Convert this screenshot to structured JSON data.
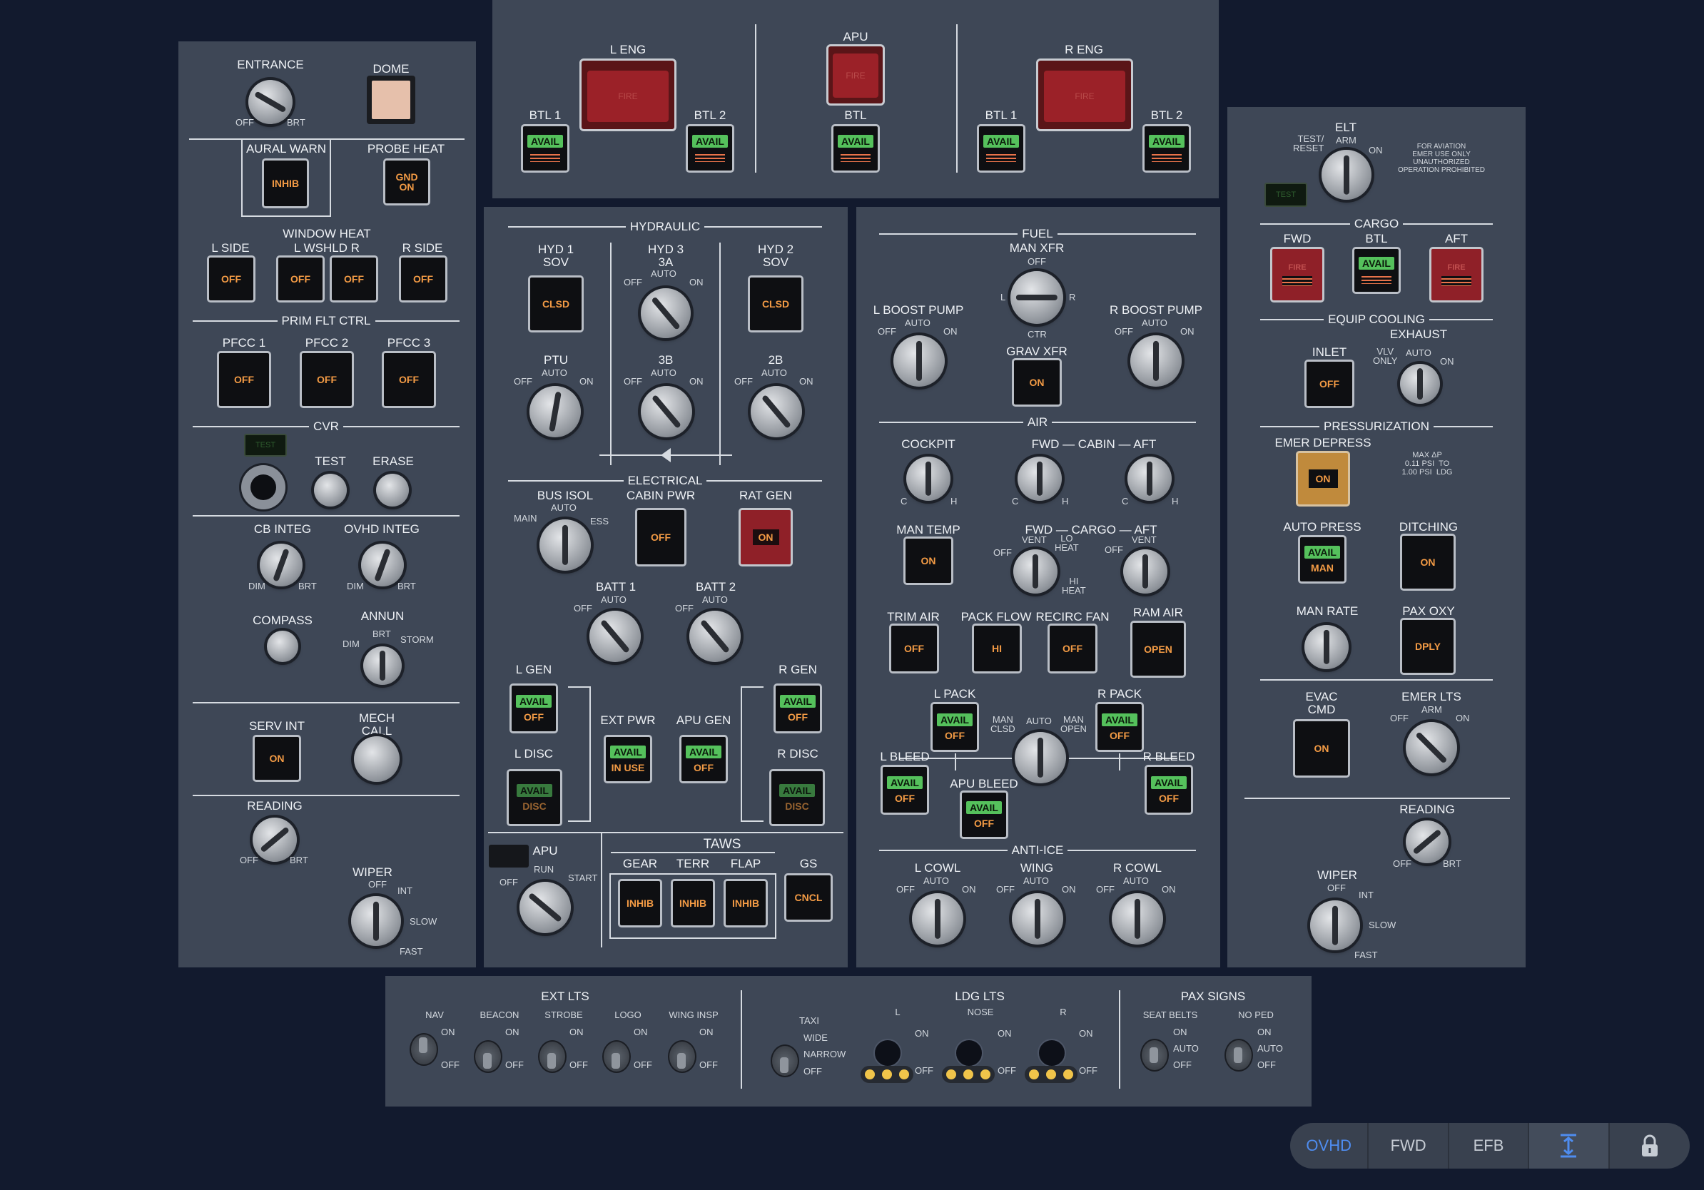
{
  "left": {
    "entrance": "ENTRANCE",
    "off": "OFF",
    "brt": "BRT",
    "dome": "DOME",
    "aural_warn": "AURAL WARN",
    "inhib": "INHIB",
    "probe_heat": "PROBE HEAT",
    "gnd_on": "GND\nON",
    "window_heat": "WINDOW HEAT",
    "l_side": "L SIDE",
    "l_wshld_r": "L WSHLD R",
    "r_side": "R SIDE",
    "off_label": "OFF",
    "prim_flt": "PRIM FLT CTRL",
    "pfcc1": "PFCC 1",
    "pfcc2": "PFCC 2",
    "pfcc3": "PFCC 3",
    "cvr": "CVR",
    "test": "TEST",
    "erase": "ERASE",
    "cb_integ": "CB INTEG",
    "ovhd_integ": "OVHD INTEG",
    "dim": "DIM",
    "compass": "COMPASS",
    "annun": "ANNUN",
    "storm": "STORM",
    "serv_int": "SERV INT",
    "on": "ON",
    "mech_call": "MECH\nCALL",
    "reading": "READING",
    "wiper": "WIPER",
    "int": "INT",
    "slow": "SLOW",
    "fast": "FAST"
  },
  "fire": {
    "l_eng": "L ENG",
    "apu": "APU",
    "r_eng": "R ENG",
    "fire": "FIRE",
    "btl1": "BTL 1",
    "btl2": "BTL 2",
    "btl": "BTL",
    "avail": "AVAIL"
  },
  "hyd": {
    "title": "HYDRAULIC",
    "hyd1": "HYD 1\nSOV",
    "hyd3": "HYD 3\n3A",
    "hyd2": "HYD 2\nSOV",
    "clsd": "CLSD",
    "auto": "AUTO",
    "off": "OFF",
    "on": "ON",
    "ptu": "PTU",
    "b3": "3B",
    "b2": "2B"
  },
  "elec": {
    "title": "ELECTRICAL",
    "bus_isol": "BUS ISOL",
    "main": "MAIN",
    "ess": "ESS",
    "cabin_pwr": "CABIN PWR",
    "rat_gen": "RAT GEN",
    "off": "OFF",
    "on": "ON",
    "batt1": "BATT 1",
    "batt2": "BATT 2",
    "auto": "AUTO",
    "l_gen": "L GEN",
    "r_gen": "R GEN",
    "ext_pwr": "EXT PWR",
    "apu_gen": "APU GEN",
    "in_use": "IN USE",
    "l_disc": "L DISC",
    "r_disc": "R DISC",
    "disc": "DISC",
    "avail": "AVAIL"
  },
  "apu": {
    "apu": "APU",
    "off": "OFF",
    "run": "RUN",
    "start": "START"
  },
  "taws": {
    "title": "TAWS",
    "gear": "GEAR",
    "terr": "TERR",
    "flap": "FLAP",
    "gs": "GS",
    "inhib": "INHIB",
    "cncl": "CNCL"
  },
  "fuel": {
    "title": "FUEL",
    "man_xfr": "MAN XFR",
    "off": "OFF",
    "l": "L",
    "r": "R",
    "ctr": "CTR",
    "l_boost": "L BOOST PUMP",
    "r_boost": "R BOOST PUMP",
    "auto": "AUTO",
    "on": "ON",
    "grav_xfr": "GRAV XFR"
  },
  "air": {
    "title": "AIR",
    "cockpit": "COCKPIT",
    "fwd_cabin_aft": "FWD — CABIN — AFT",
    "c": "C",
    "h": "H",
    "man_temp": "MAN TEMP",
    "on": "ON",
    "fwd_cargo_aft": "FWD — CARGO — AFT",
    "vent": "VENT",
    "lo_heat": "LO\nHEAT",
    "hi_heat": "HI\nHEAT",
    "off": "OFF",
    "trim_air": "TRIM AIR",
    "pack_flow": "PACK FLOW",
    "recirc_fan": "RECIRC FAN",
    "ram_air": "RAM AIR",
    "hi": "HI",
    "open": "OPEN",
    "l_pack": "L PACK",
    "r_pack": "R PACK",
    "man_clsd": "MAN\nCLSD",
    "man_open": "MAN\nOPEN",
    "auto": "AUTO",
    "l_bleed": "L BLEED",
    "r_bleed": "R BLEED",
    "apu_bleed": "APU BLEED",
    "avail": "AVAIL"
  },
  "anti_ice": {
    "title": "ANTI-ICE",
    "l_cowl": "L COWL",
    "wing": "WING",
    "r_cowl": "R COWL",
    "auto": "AUTO",
    "off": "OFF",
    "on": "ON"
  },
  "right": {
    "test_reset": "TEST/\nRESET",
    "elt": "ELT",
    "arm": "ARM",
    "on": "ON",
    "test": "TEST",
    "notice": "FOR AVIATION\nEMER USE ONLY\nUNAUTHORIZED\nOPERATION PROHIBITED",
    "cargo": "CARGO",
    "fwd": "FWD",
    "btl": "BTL",
    "aft": "AFT",
    "fire": "FIRE",
    "avail": "AVAIL",
    "equip_cooling": "EQUIP COOLING",
    "exhaust": "EXHAUST",
    "inlet": "INLET",
    "off": "OFF",
    "vlv_only": "VLV\nONLY",
    "auto": "AUTO",
    "pressurization": "PRESSURIZATION",
    "emer_depress": "EMER DEPRESS",
    "max_dp": "MAX ΔP\n0.11 PSI  TO\n1.00 PSI  LDG",
    "auto_press": "AUTO PRESS",
    "man": "MAN",
    "ditching": "DITCHING",
    "man_rate": "MAN RATE",
    "pax_oxy": "PAX OXY",
    "dply": "DPLY",
    "evac_cmd": "EVAC\nCMD",
    "emer_lts": "EMER LTS",
    "reading": "READING",
    "brt": "BRT",
    "wiper": "WIPER",
    "int": "INT",
    "slow": "SLOW",
    "fast": "FAST"
  },
  "bottom": {
    "ext_lts": "EXT LTS",
    "nav": "NAV",
    "beacon": "BEACON",
    "strobe": "STROBE",
    "logo": "LOGO",
    "wing_insp": "WING INSP",
    "on": "ON",
    "off": "OFF",
    "ldg_lts": "LDG LTS",
    "taxi": "TAXI",
    "wide": "WIDE",
    "narrow": "NARROW",
    "l": "L",
    "nose": "NOSE",
    "r": "R",
    "pax_signs": "PAX SIGNS",
    "seat_belts": "SEAT BELTS",
    "no_ped": "NO PED",
    "auto": "AUTO"
  },
  "nav": {
    "ovhd": "OVHD",
    "fwd": "FWD",
    "efb": "EFB"
  },
  "colors": {
    "panel": "#3e4756",
    "background": "#121a2e",
    "amber": "#f39b45",
    "green": "#55c15c",
    "fire_red": "#9b2128",
    "active_tab": "#4f8df0"
  },
  "icons": [
    "height-adjust-icon",
    "lock-icon"
  ]
}
